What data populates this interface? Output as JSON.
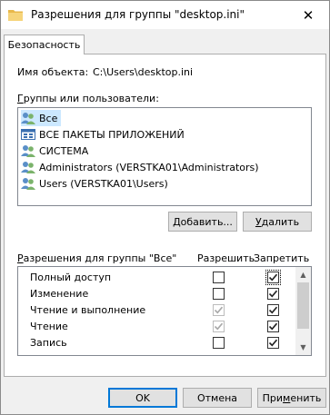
{
  "window": {
    "title": "Разрешения для группы \"desktop.ini\""
  },
  "tabs": [
    {
      "label": "Безопасность"
    }
  ],
  "object": {
    "label": "Имя объекта:",
    "value": "C:\\Users\\desktop.ini"
  },
  "groups": {
    "label_underlined": "Г",
    "label_rest": "руппы или пользователи:",
    "items": [
      {
        "label": "Все",
        "icon": "users-group-icon",
        "selected": true
      },
      {
        "label": "ВСЕ ПАКЕТЫ ПРИЛОЖЕНИЙ",
        "icon": "app-packages-icon",
        "selected": false
      },
      {
        "label": "СИСТЕМА",
        "icon": "users-group-icon",
        "selected": false
      },
      {
        "label": "Administrators (VERSTKA01\\Administrators)",
        "icon": "users-group-icon",
        "selected": false
      },
      {
        "label": "Users (VERSTKA01\\Users)",
        "icon": "users-group-icon",
        "selected": false
      }
    ],
    "add_button": {
      "pre": "",
      "underlined": "Д",
      "post": "обавить..."
    },
    "remove_button": {
      "pre": "",
      "underlined": "У",
      "post": "далить"
    }
  },
  "permissions": {
    "label_underlined": "Р",
    "label_rest": "азрешения для группы \"Все\"",
    "allow_header": "Разрешить",
    "deny_header": "Запретить",
    "rows": [
      {
        "name": "Полный доступ",
        "allow": false,
        "allow_disabled": false,
        "deny": true,
        "deny_disabled": false
      },
      {
        "name": "Изменение",
        "allow": false,
        "allow_disabled": false,
        "deny": true,
        "deny_disabled": false
      },
      {
        "name": "Чтение и выполнение",
        "allow": true,
        "allow_disabled": true,
        "deny": true,
        "deny_disabled": false
      },
      {
        "name": "Чтение",
        "allow": true,
        "allow_disabled": true,
        "deny": true,
        "deny_disabled": false
      },
      {
        "name": "Запись",
        "allow": false,
        "allow_disabled": false,
        "deny": true,
        "deny_disabled": false
      }
    ]
  },
  "buttons": {
    "ok": "OK",
    "cancel": "Отмена",
    "apply_pre": "При",
    "apply_underlined": "м",
    "apply_post": "енить"
  },
  "colors": {
    "accent": "#0078d7",
    "selection": "#cce8ff",
    "folder_icon": "#e8b84a"
  }
}
